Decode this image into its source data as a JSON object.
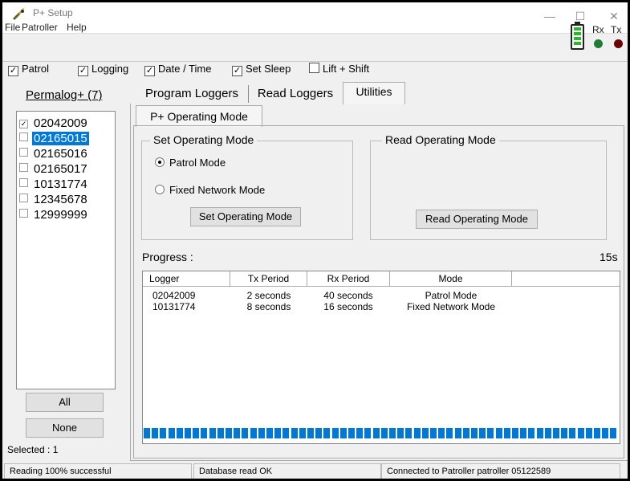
{
  "window": {
    "title": "P+ Setup",
    "controls": {
      "minimize": "—",
      "maximize": "☐",
      "close": "✕"
    }
  },
  "menu": [
    "File",
    "Patroller",
    "Help"
  ],
  "toolbar": {
    "checkboxes": [
      {
        "label": "Patrol",
        "checked": true
      },
      {
        "label": "Logging",
        "checked": true
      },
      {
        "label": "Date / Time",
        "checked": true
      },
      {
        "label": "Set Sleep",
        "checked": true
      },
      {
        "label": "Lift + Shift",
        "checked": false
      }
    ],
    "indicators": {
      "rx_label": "Rx",
      "tx_label": "Tx",
      "rx_color": "#1e7d32",
      "tx_color": "#6b0000"
    }
  },
  "left_panel": {
    "title": "Permalog+ (7)",
    "items": [
      {
        "label": "02042009",
        "checked": true,
        "selected": false
      },
      {
        "label": "02165015",
        "checked": false,
        "selected": true
      },
      {
        "label": "02165016",
        "checked": false,
        "selected": false
      },
      {
        "label": "02165017",
        "checked": false,
        "selected": false
      },
      {
        "label": "10131774",
        "checked": false,
        "selected": false
      },
      {
        "label": "12345678",
        "checked": false,
        "selected": false
      },
      {
        "label": "12999999",
        "checked": false,
        "selected": false
      }
    ],
    "all_button": "All",
    "none_button": "None",
    "selected_text": "Selected : 1"
  },
  "tabs": [
    {
      "label": "Program Loggers",
      "active": false
    },
    {
      "label": "Read Loggers",
      "active": false
    },
    {
      "label": "Utilities",
      "active": true
    }
  ],
  "subtab": "P+ Operating Mode",
  "set_mode": {
    "title": "Set Operating Mode",
    "radio_patrol": "Patrol Mode",
    "radio_fixed": "Fixed Network Mode",
    "selected": "patrol",
    "button": "Set Operating Mode"
  },
  "read_mode": {
    "title": "Read Operating Mode",
    "button": "Read Operating Mode"
  },
  "progress": {
    "label": "Progress :",
    "time": "15s",
    "fraction": 1.0,
    "columns": [
      "Logger",
      "Tx Period",
      "Rx Period",
      "Mode"
    ],
    "rows": [
      [
        "02042009",
        "2 seconds",
        "40 seconds",
        "Patrol Mode"
      ],
      [
        "10131774",
        "8 seconds",
        "16 seconds",
        "Fixed Network Mode"
      ]
    ]
  },
  "status": [
    "Reading 100% successful",
    "Database read OK",
    "Connected to Patroller patroller 05122589"
  ],
  "colors": {
    "accent": "#0078d7"
  }
}
